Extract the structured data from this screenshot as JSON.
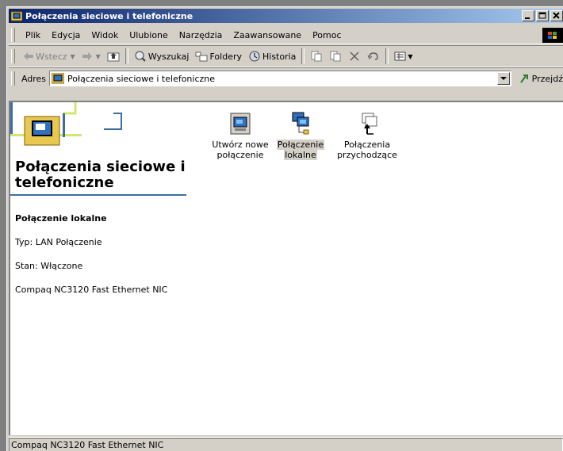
{
  "window": {
    "title": "Połączenia sieciowe i telefoniczne"
  },
  "menu": [
    "Plik",
    "Edycja",
    "Widok",
    "Ulubione",
    "Narzędzia",
    "Zaawansowane",
    "Pomoc"
  ],
  "toolbar": {
    "back": "Wstecz",
    "search": "Wyszukaj",
    "folders": "Foldery",
    "history": "Historia"
  },
  "address": {
    "label": "Adres",
    "value": "Połączenia sieciowe i telefoniczne",
    "go": "Przejdź"
  },
  "panel": {
    "title": "Połączenia sieciowe i telefoniczne",
    "selected_name": "Połączenie lokalne",
    "type": "Typ: LAN Połączenie",
    "status": "Stan: Włączone",
    "device": "Compaq NC3120 Fast Ethernet NIC"
  },
  "items": [
    {
      "line1": "Utwórz nowe",
      "line2": "połączenie",
      "icon": "new-connection-icon"
    },
    {
      "line1": "Połączenie",
      "line2": "lokalne",
      "icon": "local-connection-icon",
      "selected": true
    },
    {
      "line1": "Połączenia",
      "line2": "przychodzące",
      "icon": "incoming-connections-icon"
    }
  ],
  "statusbar": {
    "text": "Compaq NC3120 Fast Ethernet NIC"
  }
}
